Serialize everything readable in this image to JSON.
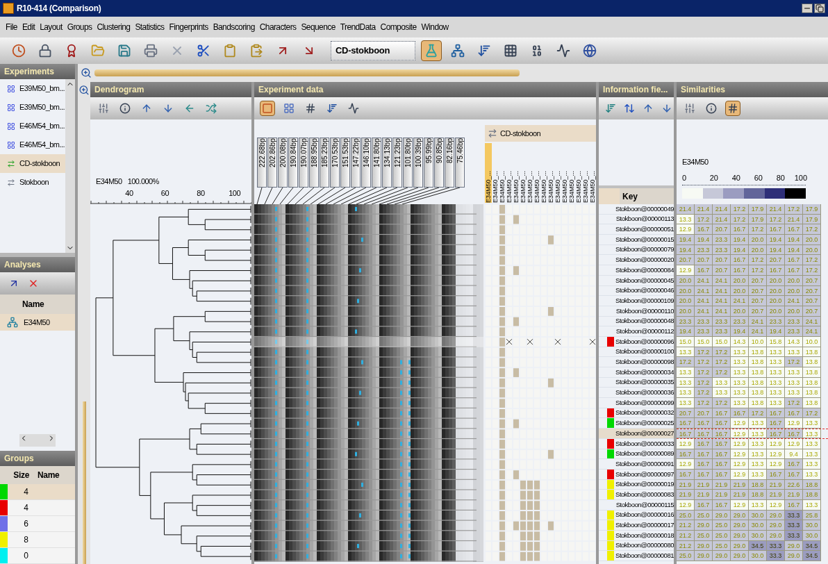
{
  "window": {
    "title": "R10-414 (Comparison)"
  },
  "menu": [
    "File",
    "Edit",
    "Layout",
    "Groups",
    "Clustering",
    "Statistics",
    "Fingerprints",
    "Bandscoring",
    "Characters",
    "Sequence",
    "TrendData",
    "Composite",
    "Window"
  ],
  "toolbar": {
    "left": [
      {
        "kind": "clock",
        "selected": false
      },
      {
        "kind": "lock",
        "selected": false
      },
      {
        "kind": "award",
        "selected": false
      },
      {
        "kind": "open",
        "selected": false
      },
      {
        "kind": "save",
        "selected": false
      },
      {
        "kind": "print",
        "selected": false
      },
      {
        "kind": "close",
        "selected": false
      },
      {
        "kind": "cut",
        "selected": false
      },
      {
        "kind": "copy",
        "selected": false
      },
      {
        "kind": "paste",
        "selected": false
      },
      {
        "kind": "export",
        "selected": false
      },
      {
        "kind": "import",
        "selected": false
      }
    ],
    "combo": "CD-stokboon",
    "right": [
      {
        "kind": "flask",
        "selected": true
      },
      {
        "kind": "tree",
        "selected": false
      },
      {
        "kind": "sort",
        "selected": false
      },
      {
        "kind": "grid",
        "selected": false
      },
      {
        "kind": "binary",
        "selected": false
      },
      {
        "kind": "chart",
        "selected": false
      },
      {
        "kind": "globe",
        "selected": false
      }
    ]
  },
  "experiments": {
    "title": "Experiments",
    "items": [
      {
        "name": "E39M50_bm...",
        "kind": "fingerprint",
        "selected": false
      },
      {
        "name": "E39M50_bm...",
        "kind": "fingerprint",
        "selected": false
      },
      {
        "name": "E46M54_bm...",
        "kind": "fingerprint",
        "selected": false
      },
      {
        "name": "E46M54_bm...",
        "kind": "fingerprint",
        "selected": false
      },
      {
        "name": "CD-stokboon",
        "kind": "character",
        "selected": true
      },
      {
        "name": "Stokboon",
        "kind": "character",
        "selected": false
      }
    ]
  },
  "analyses": {
    "title": "Analyses",
    "column": "Name",
    "rows": [
      {
        "name": "E34M50",
        "selected": true
      }
    ]
  },
  "groups": {
    "title": "Groups",
    "columns": [
      "Size",
      "Name"
    ],
    "rows": [
      {
        "size": "4",
        "color": "#00d800",
        "selected": true
      },
      {
        "size": "4",
        "color": "#e80000",
        "selected": false
      },
      {
        "size": "6",
        "color": "#7070e8",
        "selected": false
      },
      {
        "size": "8",
        "color": "#f0f000",
        "selected": false
      },
      {
        "size": "0",
        "color": "#00f0f0",
        "selected": false
      }
    ]
  },
  "dendrogram": {
    "title": "Dendrogram",
    "experiment": "E34M50",
    "similarity": "100.000%",
    "ticks": [
      "40",
      "60",
      "80",
      "100"
    ],
    "toolbar": [
      {
        "kind": "sliders",
        "selected": false
      },
      {
        "kind": "info",
        "selected": false
      },
      {
        "kind": "up",
        "selected": false
      },
      {
        "kind": "down",
        "selected": false
      },
      {
        "kind": "left",
        "selected": false
      },
      {
        "kind": "swap",
        "selected": false
      }
    ]
  },
  "experiment_data": {
    "title": "Experiment data",
    "toolbar": [
      {
        "kind": "square",
        "selected": true
      },
      {
        "kind": "colors",
        "selected": false
      },
      {
        "kind": "number",
        "selected": false
      },
      {
        "kind": "sort",
        "selected": false
      },
      {
        "kind": "chart",
        "selected": false
      }
    ],
    "bands": [
      "222.68bp",
      "202.86bp",
      "200.08bp",
      "190.84bp",
      "190.07bp",
      "188.95bp",
      "185.23bp",
      "170.53bp",
      "151.53bp",
      "147.22bp",
      "146.10bp",
      "141.80bp",
      "134.13bp",
      "121.23bp",
      "101.80bp",
      "100.39bp",
      "95.99bp",
      "90.85bp",
      "82.16bp",
      "75.46bp"
    ],
    "character_set": "CD-stokboon",
    "characters": [
      {
        "name": "E34M50_...",
        "selected": true
      },
      {
        "name": "E34M50_...",
        "selected": false
      },
      {
        "name": "E34M50_...",
        "selected": false
      },
      {
        "name": "E34M50_...",
        "selected": false
      },
      {
        "name": "E34M50_...",
        "selected": false
      },
      {
        "name": "E34M50_...",
        "selected": false
      },
      {
        "name": "E34M50_...",
        "selected": false
      },
      {
        "name": "E34M50_...",
        "selected": false
      },
      {
        "name": "E34M50_...",
        "selected": false
      },
      {
        "name": "E34M50_...",
        "selected": false
      },
      {
        "name": "E34M50_...",
        "selected": false
      },
      {
        "name": "E34M50_...",
        "selected": false
      },
      {
        "name": "E34M50_...",
        "selected": false
      },
      {
        "name": "E34M50_...",
        "selected": false
      },
      {
        "name": "E34M50_...",
        "selected": false
      },
      {
        "name": "E34M50_...",
        "selected": false
      }
    ]
  },
  "information_fields": {
    "title": "Information fie...",
    "column": "Key",
    "toolbar": [
      {
        "kind": "sortdown",
        "selected": false
      },
      {
        "kind": "sortswap",
        "selected": false
      },
      {
        "kind": "up",
        "selected": false
      },
      {
        "kind": "down",
        "selected": false
      }
    ]
  },
  "similarities": {
    "title": "Similarities",
    "experiment": "E34M50",
    "scale": [
      "0",
      "20",
      "40",
      "60",
      "80",
      "100"
    ],
    "toolbar": [
      {
        "kind": "sliders",
        "selected": false
      },
      {
        "kind": "info",
        "selected": false
      },
      {
        "kind": "number",
        "selected": true
      }
    ]
  },
  "rows": [
    {
      "key": "Stokboon@00000049",
      "selected": false,
      "values": [
        "21.4",
        "21.4",
        "21.4",
        "17.2",
        "17.9",
        "21.4",
        "17.2",
        "17.9"
      ]
    },
    {
      "key": "Stokboon@00000113",
      "selected": false,
      "values": [
        "13.3",
        "17.2",
        "21.4",
        "17.2",
        "17.9",
        "17.2",
        "21.4",
        "17.9"
      ]
    },
    {
      "key": "Stokboon@00000051",
      "selected": false,
      "values": [
        "12.9",
        "16.7",
        "20.7",
        "16.7",
        "17.2",
        "16.7",
        "16.7",
        "17.2"
      ]
    },
    {
      "key": "Stokboon@00000015",
      "selected": false,
      "values": [
        "19.4",
        "19.4",
        "23.3",
        "19.4",
        "20.0",
        "19.4",
        "19.4",
        "20.0"
      ]
    },
    {
      "key": "Stokboon@00000079",
      "selected": false,
      "values": [
        "19.4",
        "23.3",
        "23.3",
        "19.4",
        "20.0",
        "19.4",
        "19.4",
        "20.0"
      ]
    },
    {
      "key": "Stokboon@00000020",
      "selected": false,
      "values": [
        "20.7",
        "20.7",
        "20.7",
        "16.7",
        "17.2",
        "20.7",
        "16.7",
        "17.2"
      ]
    },
    {
      "key": "Stokboon@00000084",
      "selected": false,
      "values": [
        "12.9",
        "16.7",
        "20.7",
        "16.7",
        "17.2",
        "16.7",
        "16.7",
        "17.2"
      ]
    },
    {
      "key": "Stokboon@00000045",
      "selected": false,
      "values": [
        "20.0",
        "24.1",
        "24.1",
        "20.0",
        "20.7",
        "20.0",
        "20.0",
        "20.7"
      ]
    },
    {
      "key": "Stokboon@00000046",
      "selected": false,
      "values": [
        "20.0",
        "24.1",
        "24.1",
        "20.0",
        "20.7",
        "20.0",
        "20.0",
        "20.7"
      ]
    },
    {
      "key": "Stokboon@00000109",
      "selected": false,
      "values": [
        "20.0",
        "24.1",
        "24.1",
        "24.1",
        "20.7",
        "20.0",
        "24.1",
        "20.7"
      ]
    },
    {
      "key": "Stokboon@00000110",
      "selected": false,
      "values": [
        "20.0",
        "24.1",
        "24.1",
        "20.0",
        "20.7",
        "20.0",
        "20.0",
        "20.7"
      ]
    },
    {
      "key": "Stokboon@00000048",
      "selected": false,
      "values": [
        "23.3",
        "23.3",
        "23.3",
        "23.3",
        "24.1",
        "23.3",
        "23.3",
        "24.1"
      ]
    },
    {
      "key": "Stokboon@00000112",
      "selected": false,
      "values": [
        "19.4",
        "23.3",
        "23.3",
        "19.4",
        "24.1",
        "19.4",
        "23.3",
        "24.1"
      ]
    },
    {
      "key": "Stokboon@00000096",
      "color": "#e80000",
      "selected": false,
      "values": [
        "15.0",
        "15.0",
        "15.0",
        "14.3",
        "10.0",
        "15.8",
        "14.3",
        "10.0"
      ]
    },
    {
      "key": "Stokboon@00000100",
      "selected": false,
      "values": [
        "13.3",
        "17.2",
        "17.2",
        "13.3",
        "13.8",
        "13.3",
        "13.3",
        "13.8"
      ]
    },
    {
      "key": "Stokboon@00000098",
      "selected": false,
      "values": [
        "17.2",
        "17.2",
        "17.2",
        "13.3",
        "13.8",
        "13.3",
        "17.2",
        "13.8"
      ]
    },
    {
      "key": "Stokboon@00000034",
      "selected": false,
      "values": [
        "13.3",
        "17.2",
        "17.2",
        "13.3",
        "13.8",
        "13.3",
        "13.3",
        "13.8"
      ]
    },
    {
      "key": "Stokboon@00000035",
      "selected": false,
      "values": [
        "13.3",
        "17.2",
        "13.3",
        "13.3",
        "13.8",
        "13.3",
        "13.3",
        "13.8"
      ]
    },
    {
      "key": "Stokboon@00000036",
      "selected": false,
      "values": [
        "13.3",
        "17.2",
        "13.3",
        "13.3",
        "13.8",
        "13.3",
        "13.3",
        "13.8"
      ]
    },
    {
      "key": "Stokboon@00000099",
      "selected": false,
      "values": [
        "13.3",
        "17.2",
        "17.2",
        "13.3",
        "13.8",
        "13.3",
        "17.2",
        "13.8"
      ]
    },
    {
      "key": "Stokboon@00000032",
      "color": "#e80000",
      "selected": false,
      "values": [
        "20.7",
        "20.7",
        "16.7",
        "16.7",
        "17.2",
        "16.7",
        "16.7",
        "17.2"
      ]
    },
    {
      "key": "Stokboon@00000025",
      "color": "#00d800",
      "selected": false,
      "values": [
        "16.7",
        "16.7",
        "16.7",
        "12.9",
        "13.3",
        "16.7",
        "12.9",
        "13.3"
      ]
    },
    {
      "key": "Stokboon@00000027",
      "selected": true,
      "values": [
        "16.7",
        "16.7",
        "16.7",
        "12.9",
        "13.3",
        "16.7",
        "16.7",
        "13.3"
      ]
    },
    {
      "key": "Stokboon@00000033",
      "color": "#e80000",
      "selected": false,
      "values": [
        "12.9",
        "16.7",
        "16.7",
        "12.9",
        "13.3",
        "12.9",
        "12.9",
        "13.3"
      ]
    },
    {
      "key": "Stokboon@00000089",
      "color": "#00d800",
      "selected": false,
      "values": [
        "16.7",
        "16.7",
        "16.7",
        "12.9",
        "13.3",
        "12.9",
        "9.4",
        "13.3"
      ]
    },
    {
      "key": "Stokboon@00000091",
      "selected": false,
      "values": [
        "12.9",
        "16.7",
        "16.7",
        "12.9",
        "13.3",
        "12.9",
        "16.7",
        "13.3"
      ]
    },
    {
      "key": "Stokboon@00000097",
      "color": "#e80000",
      "selected": false,
      "values": [
        "16.7",
        "16.7",
        "16.7",
        "12.9",
        "13.3",
        "16.7",
        "16.7",
        "13.3"
      ]
    },
    {
      "key": "Stokboon@00000019",
      "color": "#f0f000",
      "selected": false,
      "values": [
        "21.9",
        "21.9",
        "21.9",
        "21.9",
        "18.8",
        "21.9",
        "22.6",
        "18.8"
      ]
    },
    {
      "key": "Stokboon@00000083",
      "color": "#f0f000",
      "selected": false,
      "values": [
        "21.9",
        "21.9",
        "21.9",
        "21.9",
        "18.8",
        "21.9",
        "21.9",
        "18.8"
      ]
    },
    {
      "key": "Stokboon@00000115",
      "selected": false,
      "values": [
        "12.9",
        "16.7",
        "16.7",
        "12.9",
        "13.3",
        "12.9",
        "16.7",
        "13.3"
      ]
    },
    {
      "key": "Stokboon@00000016",
      "color": "#f0f000",
      "selected": false,
      "values": [
        "25.0",
        "25.0",
        "29.0",
        "29.0",
        "30.0",
        "29.0",
        "33.3",
        "25.8"
      ]
    },
    {
      "key": "Stokboon@00000017",
      "color": "#f0f000",
      "selected": false,
      "values": [
        "21.2",
        "29.0",
        "25.0",
        "29.0",
        "30.0",
        "29.0",
        "33.3",
        "30.0"
      ]
    },
    {
      "key": "Stokboon@00000018",
      "color": "#f0f000",
      "selected": false,
      "values": [
        "21.2",
        "25.0",
        "25.0",
        "29.0",
        "30.0",
        "29.0",
        "33.3",
        "30.0"
      ]
    },
    {
      "key": "Stokboon@00000080",
      "color": "#f0f000",
      "selected": false,
      "values": [
        "21.2",
        "29.0",
        "25.0",
        "29.0",
        "34.5",
        "33.3",
        "29.0",
        "34.5"
      ]
    },
    {
      "key": "Stokboon@00000081",
      "color": "#f0f000",
      "selected": false,
      "values": [
        "25.0",
        "29.0",
        "29.0",
        "29.0",
        "30.0",
        "33.3",
        "29.0",
        "34.5"
      ]
    }
  ]
}
